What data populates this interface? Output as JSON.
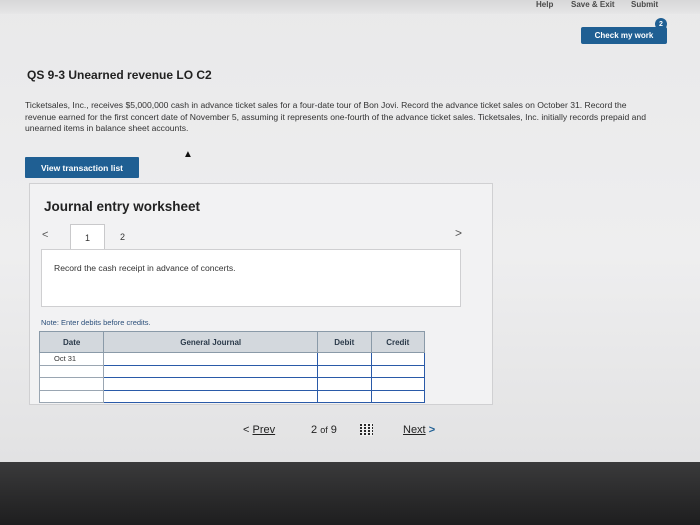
{
  "header": {
    "help": "Help",
    "save_exit": "Save & Exit",
    "submit": "Submit",
    "check_my_work": "Check my work",
    "attempts_badge": "2"
  },
  "question": {
    "title": "QS 9-3 Unearned revenue LO C2",
    "description": "Ticketsales, Inc., receives $5,000,000 cash in advance ticket sales for a four-date tour of Bon Jovi. Record the advance ticket sales on October 31. Record the revenue earned for the first concert date of November 5, assuming it represents one-fourth of the advance ticket sales. Ticketsales, Inc. initially records prepaid and unearned items in balance sheet accounts.",
    "view_transaction_list": "View transaction list"
  },
  "worksheet": {
    "title": "Journal entry worksheet",
    "prev_arrow": "<",
    "next_arrow": ">",
    "tabs": [
      "1",
      "2"
    ],
    "instruction": "Record the cash receipt in advance of concerts.",
    "note": "Note: Enter debits before credits.",
    "table": {
      "headers": [
        "Date",
        "General Journal",
        "Debit",
        "Credit"
      ],
      "rows": [
        {
          "date": "Oct 31",
          "account": "",
          "debit": "",
          "credit": ""
        },
        {
          "date": "",
          "account": "",
          "debit": "",
          "credit": ""
        },
        {
          "date": "",
          "account": "",
          "debit": "",
          "credit": ""
        },
        {
          "date": "",
          "account": "",
          "debit": "",
          "credit": ""
        }
      ]
    }
  },
  "pagination": {
    "prev": "Prev",
    "prev_icon": "<",
    "current": "2",
    "of_label": "of",
    "total": "9",
    "next": "Next",
    "next_icon": ">"
  },
  "icons": {
    "grid": "grid-icon",
    "cursor": "mouse-cursor-icon"
  }
}
